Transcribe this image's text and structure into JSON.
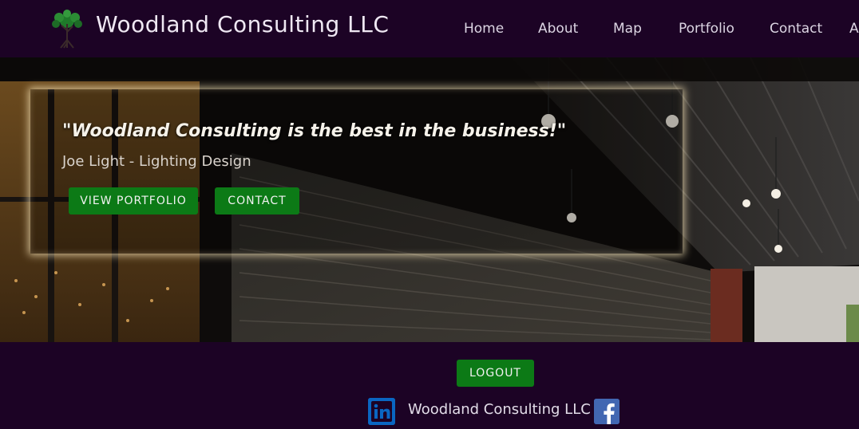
{
  "header": {
    "brand": "Woodland Consulting LLC",
    "logo_icon": "tree-icon",
    "nav": [
      {
        "label": "Home"
      },
      {
        "label": "About"
      },
      {
        "label": "Map"
      },
      {
        "label": "Portfolio"
      },
      {
        "label": "Contact"
      },
      {
        "label": "A"
      }
    ]
  },
  "hero": {
    "quote": "\"Woodland Consulting is the best in the business!\"",
    "attribution": "Joe Light - Lighting Design",
    "buttons": {
      "portfolio": "VIEW PORTFOLIO",
      "contact": "CONTACT"
    }
  },
  "footer": {
    "logout": "LOGOUT",
    "company": "Woodland Consulting LLC",
    "linkedin_icon": "linkedin-icon",
    "facebook_icon": "facebook-icon"
  },
  "colors": {
    "background": "#1c0325",
    "button_green": "#0c7a16",
    "glow": "#ffecbe",
    "linkedin": "#0a66c2",
    "facebook": "#4267b2"
  }
}
